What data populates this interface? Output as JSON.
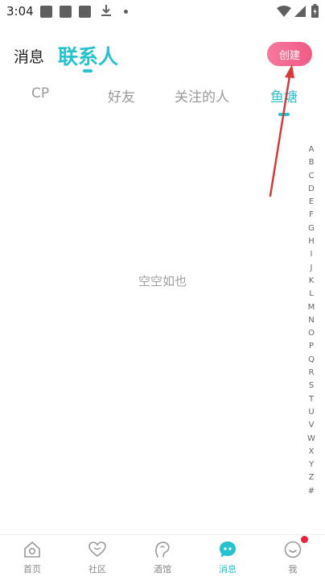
{
  "status_bar": {
    "time": "3:04"
  },
  "header": {
    "messages_tab": "消息",
    "contacts_tab": "联系人",
    "create_button": "创建"
  },
  "tabs": [
    {
      "label": "CP",
      "active": false
    },
    {
      "label": "好友",
      "active": false
    },
    {
      "label": "关注的人",
      "active": false
    },
    {
      "label": "鱼塘",
      "active": true
    }
  ],
  "empty_text": "空空如也",
  "index_letters": [
    "A",
    "B",
    "C",
    "D",
    "E",
    "F",
    "G",
    "H",
    "I",
    "J",
    "K",
    "L",
    "M",
    "N",
    "O",
    "P",
    "Q",
    "R",
    "S",
    "T",
    "U",
    "V",
    "W",
    "X",
    "Y",
    "Z",
    "#"
  ],
  "bottom_nav": [
    {
      "label": "首页",
      "icon": "home-icon",
      "active": false
    },
    {
      "label": "社区",
      "icon": "heart-icon",
      "active": false
    },
    {
      "label": "酒馆",
      "icon": "tavern-icon",
      "active": false
    },
    {
      "label": "消息",
      "icon": "message-icon",
      "active": true
    },
    {
      "label": "我",
      "icon": "smile-icon",
      "active": false,
      "badge": true
    }
  ],
  "colors": {
    "accent": "#25c2cf",
    "create_button": "#ef5a86",
    "annotation_arrow": "#d83a3a",
    "badge": "#ef1f3a"
  }
}
